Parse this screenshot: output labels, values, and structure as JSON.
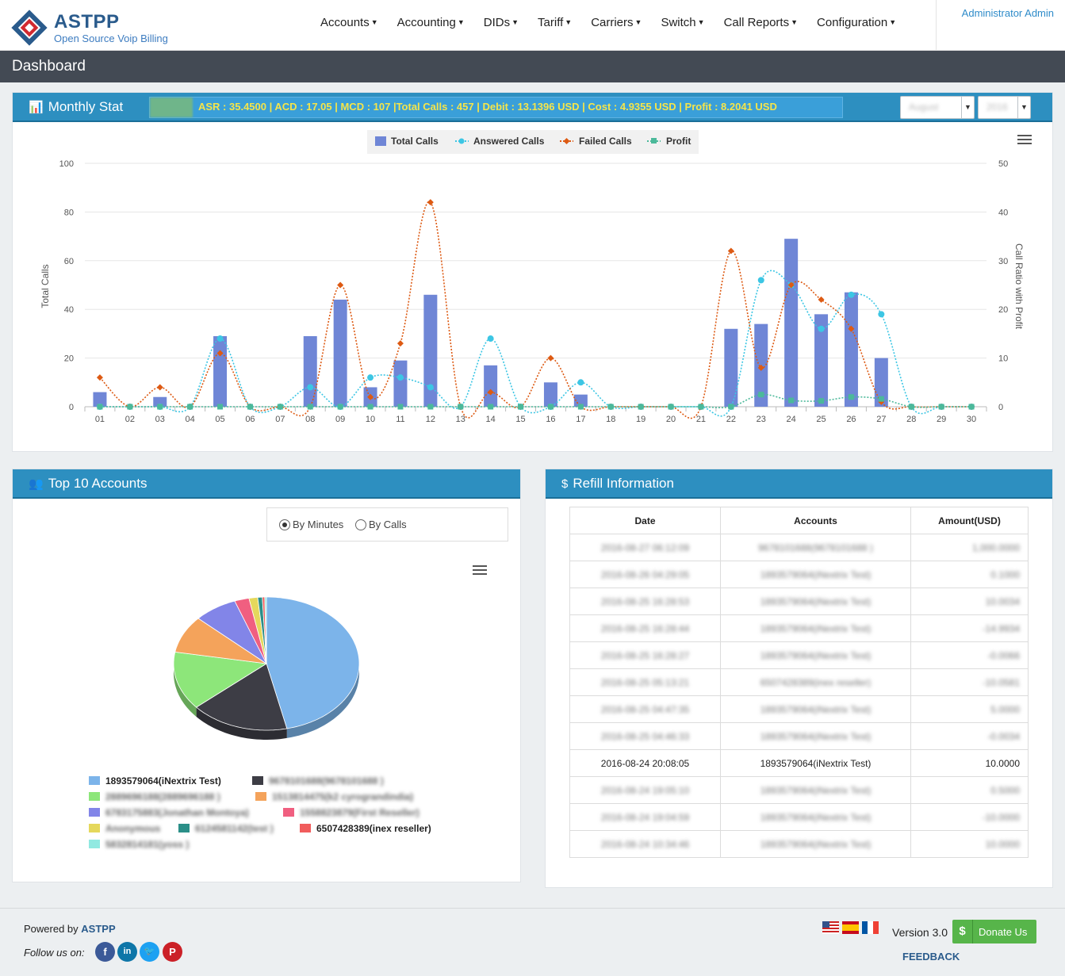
{
  "brand": {
    "title": "ASTPP",
    "subtitle": "Open Source Voip Billing"
  },
  "nav": [
    "Accounts",
    "Accounting",
    "DIDs",
    "Tariff",
    "Carriers",
    "Switch",
    "Call Reports",
    "Configuration"
  ],
  "user": "Administrator Admin",
  "page_title": "Dashboard",
  "monthly": {
    "title": "Monthly Stat",
    "stats": "ASR : 35.4500 | ACD : 17.05 | MCD : 107 |Total Calls : 457 | Debit : 13.1396 USD | Cost : 4.9355 USD | Profit : 8.2041 USD",
    "month": "August",
    "year": "2016"
  },
  "colors": {
    "total": "#6f86d6",
    "answered": "#3cc6e4",
    "failed": "#dd5a13",
    "profit": "#4bb99a"
  },
  "chart_data": {
    "type": "bar",
    "categories": [
      "01",
      "02",
      "03",
      "04",
      "05",
      "06",
      "07",
      "08",
      "09",
      "10",
      "11",
      "12",
      "13",
      "14",
      "15",
      "16",
      "17",
      "18",
      "19",
      "20",
      "21",
      "22",
      "23",
      "24",
      "25",
      "26",
      "27",
      "28",
      "29",
      "30"
    ],
    "series": [
      {
        "name": "Total Calls",
        "type": "bar",
        "axis": "left",
        "values": [
          6,
          0,
          4,
          0,
          29,
          0,
          0,
          29,
          44,
          8,
          19,
          46,
          0,
          17,
          0,
          10,
          5,
          0,
          0,
          0,
          0,
          32,
          34,
          69,
          38,
          47,
          20,
          0,
          0,
          0
        ]
      },
      {
        "name": "Answered Calls",
        "type": "line",
        "axis": "right",
        "values": [
          0,
          0,
          0,
          0,
          14,
          0,
          0,
          4,
          0,
          6,
          6,
          4,
          0,
          14,
          0,
          0,
          5,
          0,
          0,
          0,
          0,
          0,
          26,
          25,
          16,
          23,
          19,
          0,
          0,
          0
        ]
      },
      {
        "name": "Failed Calls",
        "type": "line",
        "axis": "right",
        "values": [
          6,
          0,
          4,
          0,
          11,
          0,
          0,
          0,
          25,
          2,
          13,
          42,
          0,
          3,
          0,
          10,
          0,
          0,
          0,
          0,
          0,
          32,
          8,
          25,
          22,
          16,
          1,
          0,
          0,
          0
        ]
      },
      {
        "name": "Profit",
        "type": "line",
        "axis": "right",
        "values": [
          0,
          0,
          0,
          0,
          0,
          0,
          0,
          0,
          0,
          0,
          0,
          0,
          0,
          0,
          0,
          0,
          0,
          0,
          0,
          0,
          0,
          0,
          2.5,
          1.3,
          1.2,
          2,
          1.6,
          0,
          0,
          0
        ]
      }
    ],
    "ylabel": "Total Calls",
    "y2label": "Call Ratio with Profit",
    "ylim": [
      0,
      100
    ],
    "y2lim": [
      0,
      50
    ],
    "yticks": [
      0,
      20,
      40,
      60,
      80,
      100
    ],
    "y2ticks": [
      0,
      10,
      20,
      30,
      40,
      50
    ],
    "grid": true,
    "legend": "top-center"
  },
  "top_accounts": {
    "title": "Top 10 Accounts",
    "by_minutes": "By Minutes",
    "by_calls": "By Calls",
    "chart_data": {
      "type": "pie",
      "slices": [
        {
          "label": "1893579064(iNextrix Test)",
          "value": 46,
          "color": "#7cb4ea"
        },
        {
          "label": "9678101688(9678101688 )",
          "value": 17,
          "color": "#3d3d45"
        },
        {
          "label": "2889696188(2889696188 )",
          "value": 14,
          "color": "#8de67a"
        },
        {
          "label": "1513814475(k2 cyrograndindia)",
          "value": 9,
          "color": "#f4a35b"
        },
        {
          "label": "6783175883(Jonathan Montoya)",
          "value": 7.5,
          "color": "#8285e8"
        },
        {
          "label": "1558823879(First Reseller)",
          "value": 2.5,
          "color": "#f05f80"
        },
        {
          "label": "Anonymous",
          "value": 1.5,
          "color": "#e5d85c"
        },
        {
          "label": "6124581142(test )",
          "value": 0.8,
          "color": "#2b8f88"
        },
        {
          "label": "6507428389(inex reseller)",
          "value": 0.4,
          "color": "#f15c5c"
        },
        {
          "label": "5832814181(yoss )",
          "value": 0.3,
          "color": "#91e9e1"
        }
      ]
    }
  },
  "refill": {
    "title": "Refill Information",
    "headers": [
      "Date",
      "Accounts",
      "Amount(USD)"
    ],
    "rows": [
      [
        "2016-08-27 06:12:09",
        "9678101688(9678101688 )",
        "1,000.0000"
      ],
      [
        "2016-08-26 04:29:05",
        "1893579064(iNextrix Test)",
        "0.1000"
      ],
      [
        "2016-08-25 16:28:53",
        "1893579064(iNextrix Test)",
        "10.0034"
      ],
      [
        "2016-08-25 16:28:44",
        "1893579064(iNextrix Test)",
        "-14.9934"
      ],
      [
        "2016-08-25 16:28:27",
        "1893579064(iNextrix Test)",
        "-0.0066"
      ],
      [
        "2016-08-25 05:13:21",
        "6507428389(inex reseller)",
        "-10.0581"
      ],
      [
        "2016-08-25 04:47:35",
        "1893579064(iNextrix Test)",
        "5.0000"
      ],
      [
        "2016-08-25 04:46:33",
        "1893579064(iNextrix Test)",
        "-0.0034"
      ],
      [
        "2016-08-24 20:08:05",
        "1893579064(iNextrix Test)",
        "10.0000"
      ],
      [
        "2016-08-24 19:05:10",
        "1893579064(iNextrix Test)",
        "0.5000"
      ],
      [
        "2016-08-24 19:04:59",
        "1893579064(iNextrix Test)",
        "-10.0000"
      ],
      [
        "2016-08-24 10:34:46",
        "1893579064(iNextrix Test)",
        "10.0000"
      ]
    ],
    "clear_row": 8
  },
  "footer": {
    "powered_prefix": "Powered by",
    "powered_brand": "ASTPP",
    "follow": "Follow us on:",
    "version": "Version 3.0",
    "donate": "Donate Us",
    "feedback": "FEEDBACK"
  }
}
